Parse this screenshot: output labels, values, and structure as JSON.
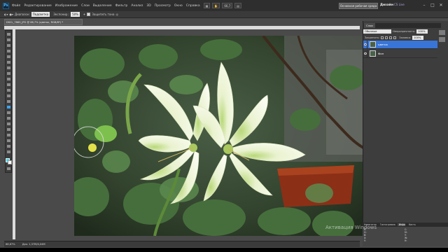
{
  "menubar": {
    "logo": "Ps",
    "items": [
      "Файл",
      "Редактирование",
      "Изображение",
      "Слои",
      "Выделение",
      "Фильтр",
      "Анализ",
      "3D",
      "Просмотр",
      "Окно",
      "Справка"
    ],
    "zoom_display": "66,7",
    "workspace_button": "Основная рабочая среда",
    "design_label": "Дизайн",
    "cs_live": "CS Live",
    "window_controls": [
      "–",
      "□",
      "✕"
    ]
  },
  "options": {
    "range_label": "Диапазон:",
    "range_value": "Подсветка",
    "exposure_label": "Экспонир.:",
    "exposure_value": "50%",
    "protect_label": "Защитить тона",
    "tool_preset": "color-replace"
  },
  "document": {
    "tab_title": "DSCL_7865_JPG @ 66,7% (цветок, RGB/8*) *",
    "status_zoom": "66,67%",
    "status_doc": "Док: 1,37M/4,04M"
  },
  "toolbar": {
    "active_tool": "dodge-tool",
    "foreground_color": "#3fd8f4",
    "background_color": "#ffffff"
  },
  "layers_panel": {
    "tab_label": "Слои",
    "blend_mode": "Обычные",
    "opacity_label": "Непрозрачность:",
    "opacity_value": "100%",
    "lock_label": "Закрепить:",
    "fill_label": "Заливка:",
    "fill_value": "100%",
    "layers": [
      {
        "name": "цветок",
        "visible": true,
        "selected": true
      },
      {
        "name": "Фон",
        "visible": true,
        "selected": false
      }
    ]
  },
  "info_panel": {
    "tabs": [
      "Навигатор",
      "Гистограмма",
      "Инфо",
      "Кисть"
    ],
    "active_tab": "Инфо",
    "cells": [
      "R:\nG:\nB:",
      "C:\nM:\nY:",
      "X:\nY:",
      "W:\nH:"
    ]
  },
  "watermark": {
    "text": "Активация Windows"
  }
}
